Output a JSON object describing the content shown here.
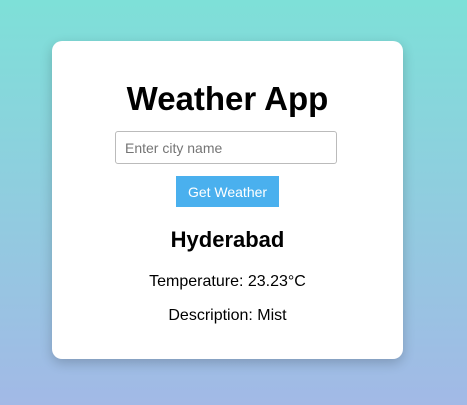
{
  "app": {
    "title": "Weather App"
  },
  "search": {
    "placeholder": "Enter city name",
    "value": "",
    "button_label": "Get Weather"
  },
  "result": {
    "city": "Hyderabad",
    "temperature": "Temperature: 23.23°C",
    "description": "Description: Mist"
  }
}
